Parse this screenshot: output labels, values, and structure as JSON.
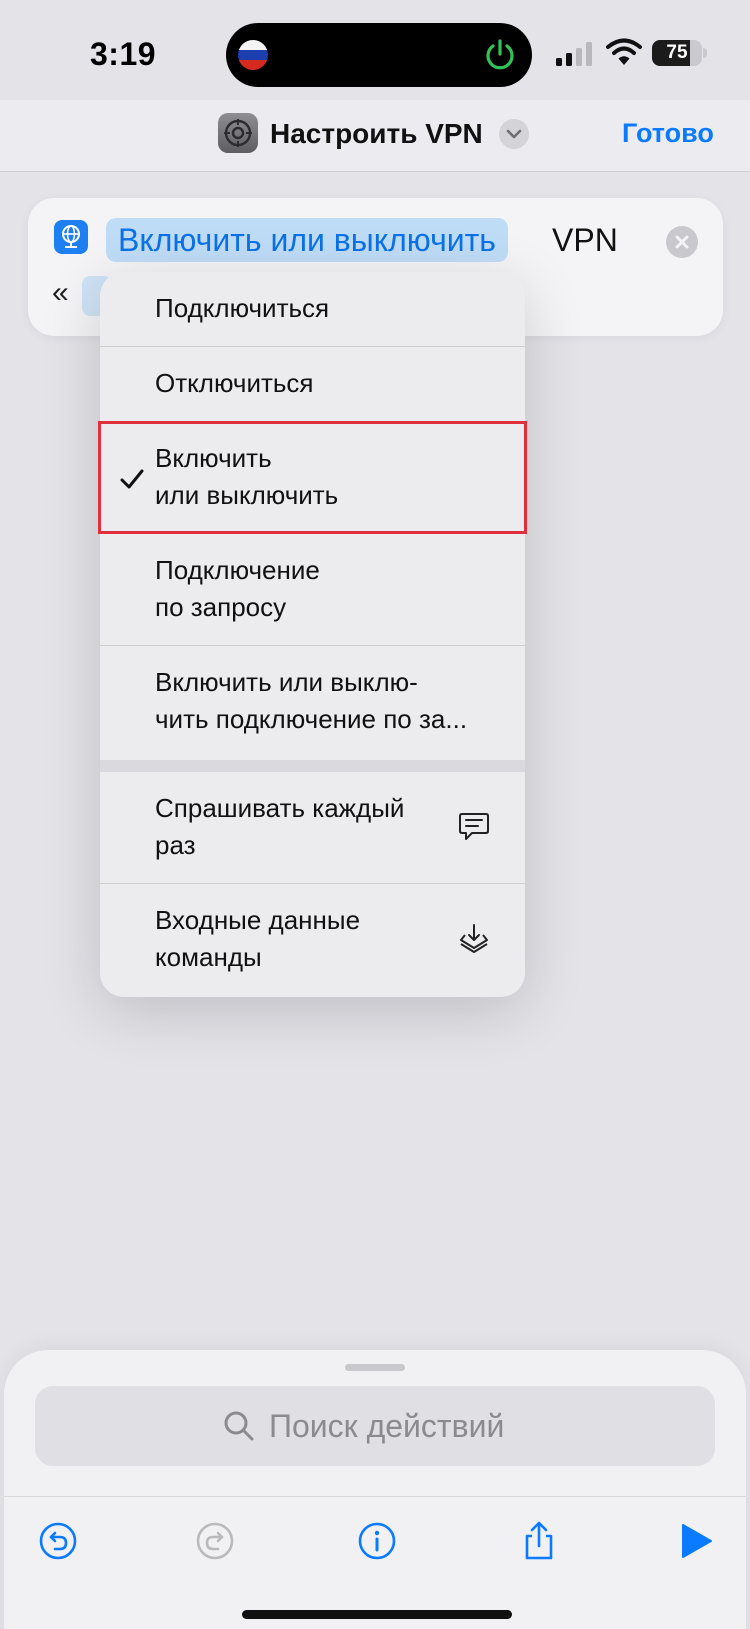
{
  "status_bar": {
    "time": "3:19",
    "battery": "75",
    "battery_level": 0.75
  },
  "navbar": {
    "title": "Настроить VPN",
    "done": "Готово"
  },
  "action": {
    "token": "Включить или выключить",
    "suffix": "VPN",
    "quote": "«"
  },
  "menu": {
    "items": [
      {
        "lines": [
          "Подключиться"
        ]
      },
      {
        "lines": [
          "Отключиться"
        ]
      },
      {
        "lines": [
          "Включить",
          "или выключить"
        ],
        "selected": true
      },
      {
        "lines": [
          "Подключение",
          "по запросу"
        ]
      },
      {
        "lines": [
          "Включить или выклю-",
          "чить подключение по за..."
        ]
      },
      {
        "lines": [
          "Спрашивать каждый",
          "раз"
        ],
        "icon": "speech-bubble-icon"
      },
      {
        "lines": [
          "Входные данные",
          "команды"
        ],
        "icon": "shortcut-input-icon"
      }
    ]
  },
  "search": {
    "placeholder": "Поиск действий"
  },
  "colors": {
    "accent": "#0a7aff",
    "highlight": "#e0303c",
    "power": "#32c356"
  }
}
